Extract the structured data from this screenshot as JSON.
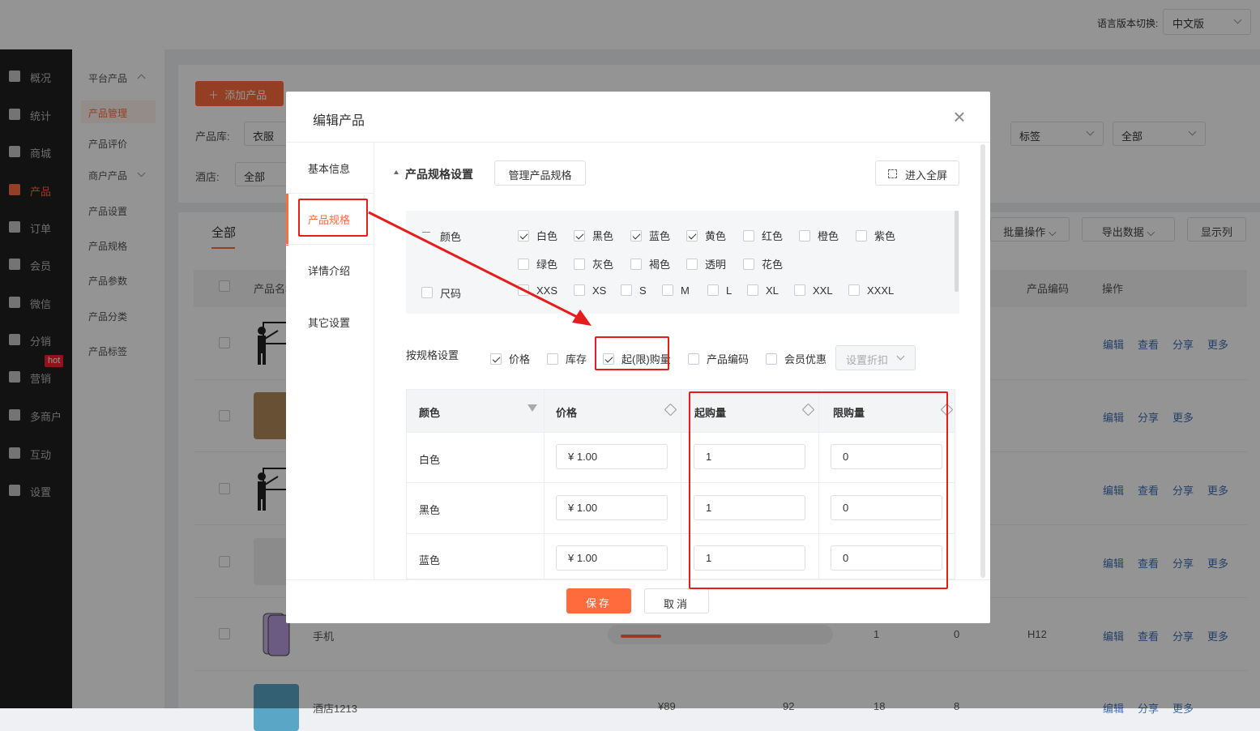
{
  "topbar": {
    "lang_label": "语言版本切换:",
    "lang_value": "中文版"
  },
  "sidebar": {
    "items": [
      {
        "label": "概况",
        "icon": "layers-icon"
      },
      {
        "label": "统计",
        "icon": "chart-icon"
      },
      {
        "label": "商城",
        "icon": "store-icon"
      },
      {
        "label": "产品",
        "icon": "product-icon"
      },
      {
        "label": "订单",
        "icon": "order-icon"
      },
      {
        "label": "会员",
        "icon": "crown-icon"
      },
      {
        "label": "微信",
        "icon": "wechat-icon"
      },
      {
        "label": "分销",
        "icon": "distribution-icon"
      },
      {
        "label": "营销",
        "icon": "flag-icon"
      },
      {
        "label": "多商户",
        "icon": "merchant-icon"
      },
      {
        "label": "互动",
        "icon": "interact-icon"
      },
      {
        "label": "设置",
        "icon": "gear-icon"
      }
    ],
    "hot_badge": "hot"
  },
  "subnav": {
    "items": [
      "平台产品",
      "产品管理",
      "产品评价",
      "商户产品",
      "产品设置",
      "产品规格",
      "产品参数",
      "产品分类",
      "产品标签"
    ]
  },
  "background": {
    "add_product": "添加产品",
    "library_label": "产品库:",
    "library_value": "衣服",
    "hotel_label": "酒店:",
    "hotel_value": "全部",
    "tag_select": "标签",
    "all_select": "全部",
    "tab_all": "全部",
    "batch_btn": "批量操作",
    "export_btn": "导出数据",
    "columns_btn": "显示列",
    "col_name": "产品名称",
    "col_code": "产品编码",
    "col_ops": "操作",
    "row_phone": {
      "name": "手机",
      "v1": "1",
      "v2": "0",
      "code": "H12"
    },
    "row_hotel": {
      "name": "酒店1213",
      "price": "¥89",
      "v1": "92",
      "v2": "18",
      "v3": "8"
    },
    "actions": {
      "edit": "编辑",
      "view": "查看",
      "share": "分享",
      "more": "更多"
    }
  },
  "modal": {
    "title": "编辑产品",
    "close_icon": "×",
    "tabs": [
      "基本信息",
      "产品规格",
      "详情介绍",
      "其它设置"
    ],
    "section_title": "产品规格设置",
    "manage_btn": "管理产品规格",
    "fullscreen_btn": "进入全屏",
    "color_group": "颜色",
    "size_group": "尺码",
    "colors": [
      {
        "label": "白色",
        "checked": true
      },
      {
        "label": "黑色",
        "checked": true
      },
      {
        "label": "蓝色",
        "checked": true
      },
      {
        "label": "黄色",
        "checked": true
      },
      {
        "label": "红色",
        "checked": false
      },
      {
        "label": "橙色",
        "checked": false
      },
      {
        "label": "紫色",
        "checked": false
      },
      {
        "label": "绿色",
        "checked": false
      },
      {
        "label": "灰色",
        "checked": false
      },
      {
        "label": "褐色",
        "checked": false
      },
      {
        "label": "透明",
        "checked": false
      },
      {
        "label": "花色",
        "checked": false
      }
    ],
    "sizes": [
      "XXS",
      "XS",
      "S",
      "M",
      "L",
      "XL",
      "XXL",
      "XXXL"
    ],
    "by_spec_label": "按规格设置",
    "by_spec_opts": [
      {
        "label": "价格",
        "checked": true
      },
      {
        "label": "库存",
        "checked": false
      },
      {
        "label": "起(限)购量",
        "checked": true
      },
      {
        "label": "产品编码",
        "checked": false
      },
      {
        "label": "会员优惠",
        "checked": false
      }
    ],
    "discount_placeholder": "设置折扣",
    "table": {
      "headers": [
        "颜色",
        "价格",
        "起购量",
        "限购量"
      ],
      "rows": [
        {
          "color": "白色",
          "price": "¥  1.00",
          "min": "1",
          "max": "0"
        },
        {
          "color": "黑色",
          "price": "¥  1.00",
          "min": "1",
          "max": "0"
        },
        {
          "color": "蓝色",
          "price": "¥  1.00",
          "min": "1",
          "max": "0"
        }
      ]
    },
    "save_btn": "保存",
    "cancel_btn": "取消"
  },
  "annotation": {
    "highlight_color": "#e81c1c",
    "accent": "#ff6b3d"
  }
}
